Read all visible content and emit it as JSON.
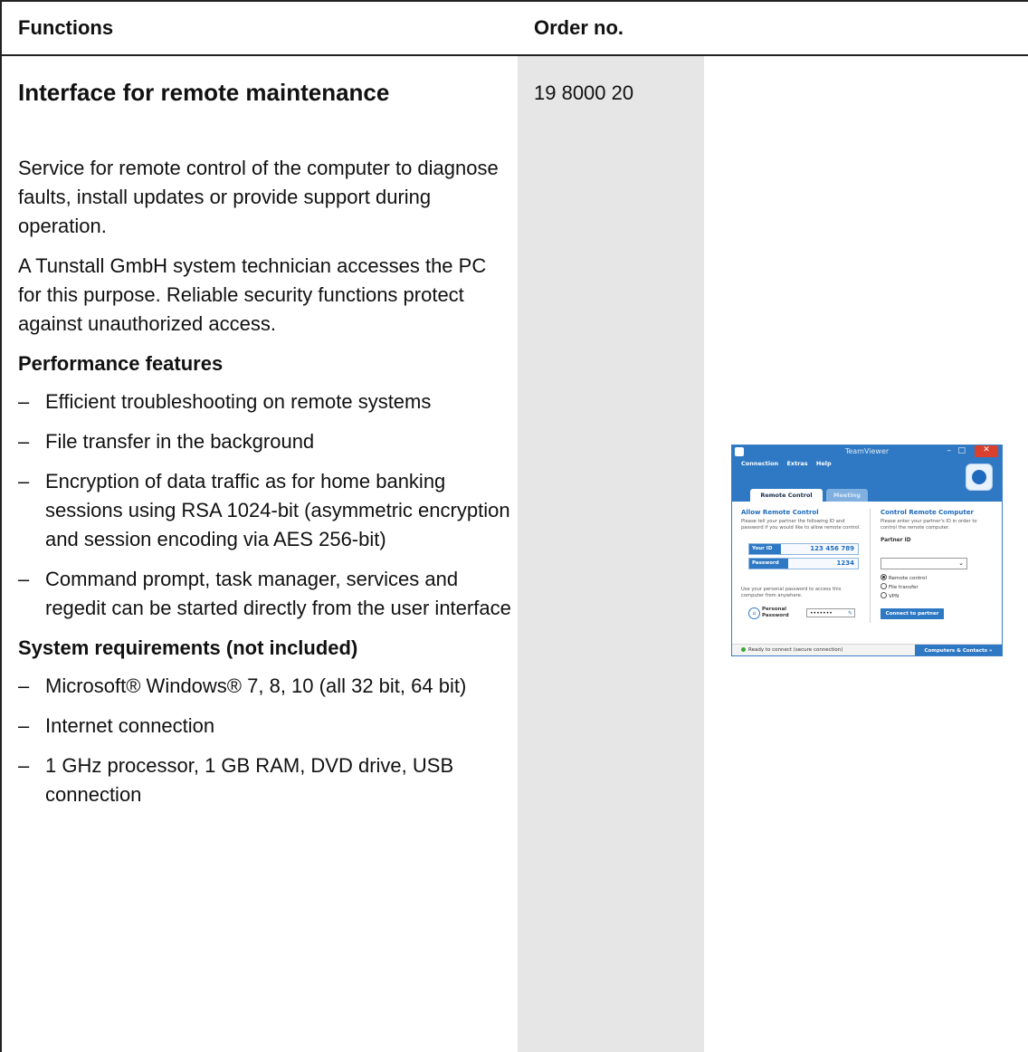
{
  "table": {
    "header_functions": "Functions",
    "header_order": "Order no."
  },
  "product": {
    "title": "Interface for remote maintenance",
    "order_no": "19 8000 20",
    "paragraphs": [
      "Service for remote control of the computer to diagnose faults, install updates or provide support during operation.",
      "A Tunstall GmbH system technician accesses the PC for this purpose. Reliable security functions protect against unauthorized access."
    ],
    "performance_heading": "Performance features",
    "performance_items": [
      "Efficient troubleshooting on remote sys­tems",
      "File transfer in the background",
      "Encryption of data traffic as for home banking sessions using RSA 1024-bit (asym­metric encryption and session encoding via AES 256-bit)",
      "Command prompt, task manager, services and regedit can be started directly from the user interface"
    ],
    "requirements_heading": "System requirements (not included)",
    "requirements_items": [
      "Microsoft® Windows® 7, 8, 10 (all 32 bit, 64 bit)",
      "Internet connection",
      "1 GHz processor, 1 GB RAM, DVD drive, USB connection"
    ]
  },
  "teamviewer": {
    "window_title": "TeamViewer",
    "menu": [
      "Connection",
      "Extras",
      "Help"
    ],
    "tab_remote": "Remote Control",
    "tab_meeting": "Meeting",
    "allow_heading": "Allow Remote Control",
    "allow_text": "Please tell your partner the following ID and password if you would like to allow remote control.",
    "your_id_label": "Your ID",
    "your_id_value": "123 456 789",
    "password_label": "Password",
    "password_value": "1234",
    "personal_text": "Use your personal password to access this computer from anywhere.",
    "personal_label": "Personal Password",
    "personal_value": "•••••••",
    "control_heading": "Control Remote Computer",
    "control_text": "Please enter your partner's ID in order to control the remote computer.",
    "partner_id_label": "Partner ID",
    "radio_options": [
      "Remote control",
      "File transfer",
      "VPN"
    ],
    "connect_button": "Connect to partner",
    "status": "Ready to connect (secure connection)",
    "computers_contacts": "Computers & Contacts  »"
  }
}
